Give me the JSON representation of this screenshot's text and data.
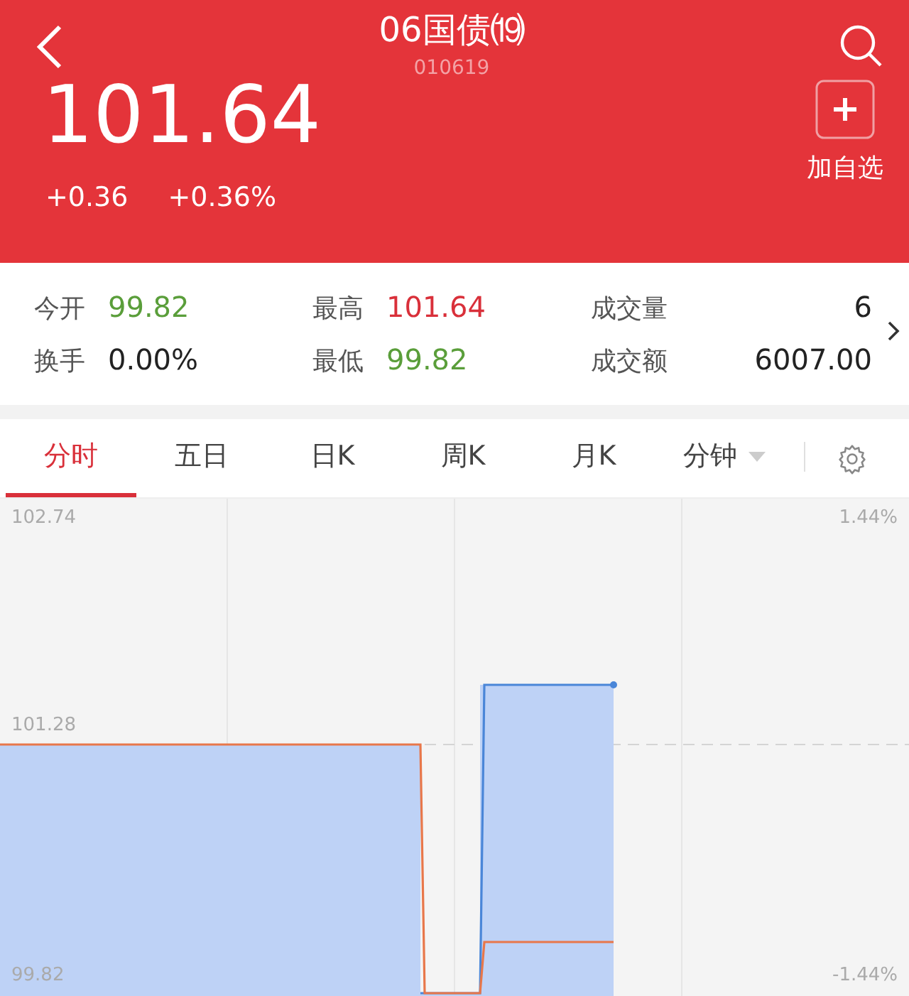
{
  "header": {
    "title": "06国债⒆",
    "code": "010619",
    "price": "101.64",
    "change": "+0.36",
    "change_percent": "+0.36%",
    "add_button": {
      "label": "加自选"
    }
  },
  "stats": [
    {
      "label": "今开",
      "value": "99.82",
      "color": "#5a9e3a"
    },
    {
      "label": "最高",
      "value": "101.64",
      "color": "#d9303a"
    },
    {
      "label": "成交量",
      "value": "6",
      "color": "#222222"
    },
    {
      "label": "换手",
      "value": "0.00%",
      "color": "#222222"
    },
    {
      "label": "最低",
      "value": "99.82",
      "color": "#5a9e3a"
    },
    {
      "label": "成交额",
      "value": "6007.00",
      "color": "#222222"
    }
  ],
  "tabs": [
    {
      "label": "分时",
      "selected": true,
      "kind": "plain"
    },
    {
      "label": "五日",
      "selected": false,
      "kind": "plain"
    },
    {
      "label": "日K",
      "selected": false,
      "kind": "plain"
    },
    {
      "label": "周K",
      "selected": false,
      "kind": "plain"
    },
    {
      "label": "月K",
      "selected": false,
      "kind": "plain"
    },
    {
      "label": "分钟",
      "selected": false,
      "kind": "dropdown"
    }
  ],
  "chart": {
    "left_labels": [
      "102.74",
      "101.28",
      "99.82"
    ],
    "right_labels": [
      "1.44%",
      "-1.44%"
    ]
  }
}
